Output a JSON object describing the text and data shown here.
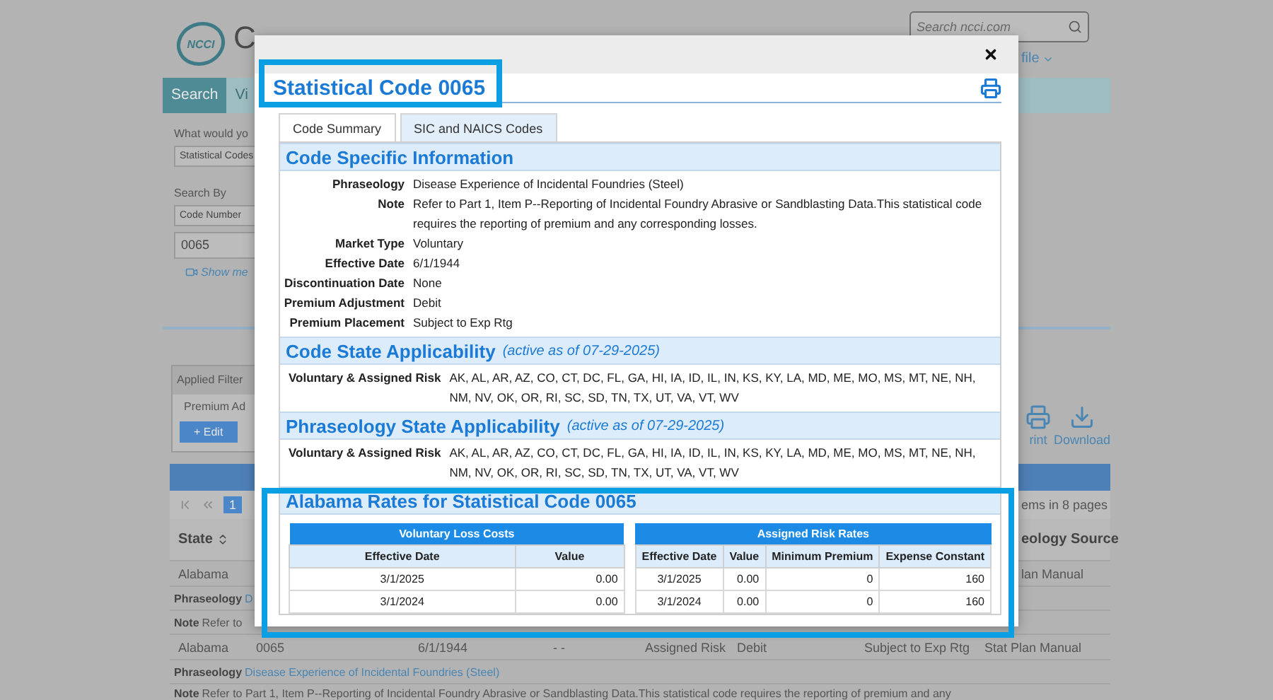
{
  "background": {
    "header": {
      "logo_text": "NCCI",
      "title": "C",
      "search": {
        "placeholder": "Search ncci.com"
      },
      "profile_link": "file"
    },
    "nav": [
      {
        "label": "Search",
        "selected": true
      },
      {
        "label": "Vi",
        "selected": false
      }
    ],
    "form": {
      "question": "What would yo",
      "type_select": "Statistical Codes",
      "search_by_label": "Search By",
      "search_by_select": "Code Number",
      "code_input": "0065",
      "video_link": "Show me"
    },
    "filters": {
      "title": "Applied Filter",
      "items": [
        "Premium Ad"
      ],
      "edit_button": "+ Edit"
    },
    "actions": [
      {
        "kind": "print",
        "label": "rint"
      },
      {
        "kind": "download",
        "label": "Download"
      }
    ],
    "pager": {
      "pages": [
        {
          "label": "1",
          "selected": true
        }
      ],
      "summary": "ems in 8 pages"
    },
    "table": {
      "header": {
        "state": {
          "label": "State",
          "sortable": true
        },
        "phraseology_source": {
          "label": "eology Source",
          "sortable": false
        }
      },
      "rows": [
        {
          "kind": "data",
          "partial": true,
          "state": "Alabama",
          "phraseology_source": "lan Manual"
        },
        {
          "kind": "phraseology",
          "label": "Phraseology",
          "text": "D"
        },
        {
          "kind": "note",
          "label": "Note",
          "text": "Refer to"
        },
        {
          "kind": "data",
          "partial": false,
          "state": "Alabama",
          "code": "0065",
          "effective_date": "6/1/1944",
          "column_4": "- -",
          "market_type": "Assigned Risk",
          "premium_adjustment": "Debit",
          "premium_placement": "Subject to Exp Rtg",
          "phraseology_source": "Stat Plan Manual"
        },
        {
          "kind": "phraseology",
          "label": "Phraseology",
          "text": "Disease Experience of Incidental Foundries (Steel)"
        },
        {
          "kind": "note",
          "label": "Note",
          "text": "Refer to Part 1, Item P--Reporting of Incidental Foundry Abrasive or Sandblasting Data.This statistical code requires the reporting of premium and any"
        }
      ]
    }
  },
  "modal": {
    "title": "Statistical Code 0065",
    "tabs": [
      {
        "label": "Code Summary",
        "selected": true
      },
      {
        "label": "SIC and NAICS Codes",
        "selected": false
      }
    ],
    "code_info": {
      "title": "Code Specific Information",
      "fields": [
        {
          "label": "Phraseology",
          "value": "Disease Experience of Incidental Foundries (Steel)"
        },
        {
          "label": "Note",
          "value": "Refer to Part 1, Item P--Reporting of Incidental Foundry Abrasive or Sandblasting Data.This statistical code requires the reporting of premium and any corresponding losses."
        },
        {
          "label": "Market Type",
          "value": "Voluntary"
        },
        {
          "label": "Effective Date",
          "value": "6/1/1944"
        },
        {
          "label": "Discontinuation Date",
          "value": "None"
        },
        {
          "label": "Premium Adjustment",
          "value": "Debit"
        },
        {
          "label": "Premium Placement",
          "value": "Subject to Exp Rtg"
        }
      ]
    },
    "applicability": [
      {
        "title": "Code State Applicability",
        "active_as_of": "(active as of 07-29-2025)",
        "fields": [
          {
            "label": "Voluntary & Assigned Risk",
            "value": "AK, AL, AR, AZ, CO, CT, DC, FL, GA, HI, IA, ID, IL, IN, KS, KY, LA, MD, ME, MO, MS, MT, NE, NH, NM, NV, OK, OR, RI, SC, SD, TN, TX, UT, VA, VT, WV"
          }
        ]
      },
      {
        "title": "Phraseology State Applicability",
        "active_as_of": "(active as of 07-29-2025)",
        "fields": [
          {
            "label": "Voluntary & Assigned Risk",
            "value": "AK, AL, AR, AZ, CO, CT, DC, FL, GA, HI, IA, ID, IL, IN, KS, KY, LA, MD, ME, MO, MS, MT, NE, NH, NM, NV, OK, OR, RI, SC, SD, TN, TX, UT, VA, VT, WV"
          }
        ]
      }
    ],
    "rates": {
      "title": "Alabama Rates for Statistical Code 0065",
      "tables": [
        {
          "title": "Voluntary Loss Costs",
          "columns": [
            {
              "label": "Effective Date",
              "numeric": false
            },
            {
              "label": "Value",
              "numeric": true
            }
          ],
          "rows": [
            [
              "3/1/2025",
              "0.00"
            ],
            [
              "3/1/2024",
              "0.00"
            ]
          ]
        },
        {
          "title": "Assigned Risk Rates",
          "columns": [
            {
              "label": "Effective Date",
              "numeric": false
            },
            {
              "label": "Value",
              "numeric": true
            },
            {
              "label": "Minimum Premium",
              "numeric": true
            },
            {
              "label": "Expense Constant",
              "numeric": true
            }
          ],
          "rows": [
            [
              "3/1/2025",
              "0.00",
              "0",
              "160"
            ],
            [
              "3/1/2024",
              "0.00",
              "0",
              "160"
            ]
          ]
        }
      ]
    }
  }
}
